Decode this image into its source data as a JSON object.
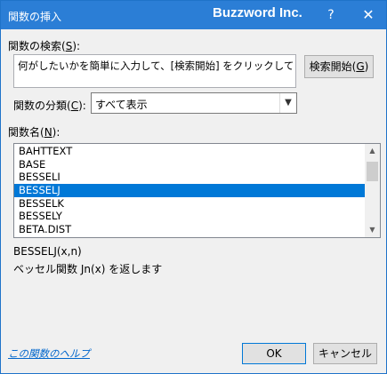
{
  "window": {
    "title": "関数の挿入",
    "brand": "Buzzword Inc.",
    "help_symbol": "?",
    "close_symbol": "✕"
  },
  "search": {
    "label": "関数の検索(",
    "label_key": "S",
    "label_end": "):",
    "value": "何がしたいかを簡単に入力して、[検索開始] をクリックしてください。",
    "button_label": "検索開始(",
    "button_key": "G",
    "button_end": ")"
  },
  "category": {
    "label": "関数の分類(",
    "label_key": "C",
    "label_end": "):",
    "selected": "すべて表示"
  },
  "function_list": {
    "label": "関数名(",
    "label_key": "N",
    "label_end": "):",
    "items": [
      "BAHTTEXT",
      "BASE",
      "BESSELI",
      "BESSELJ",
      "BESSELK",
      "BESSELY",
      "BETA.DIST"
    ],
    "selected_index": 3
  },
  "details": {
    "syntax": "BESSELJ(x,n)",
    "description": "ベッセル関数 Jn(x) を返します"
  },
  "footer": {
    "help_link": "この関数のヘルプ",
    "ok_label": "OK",
    "cancel_label": "キャンセル"
  }
}
